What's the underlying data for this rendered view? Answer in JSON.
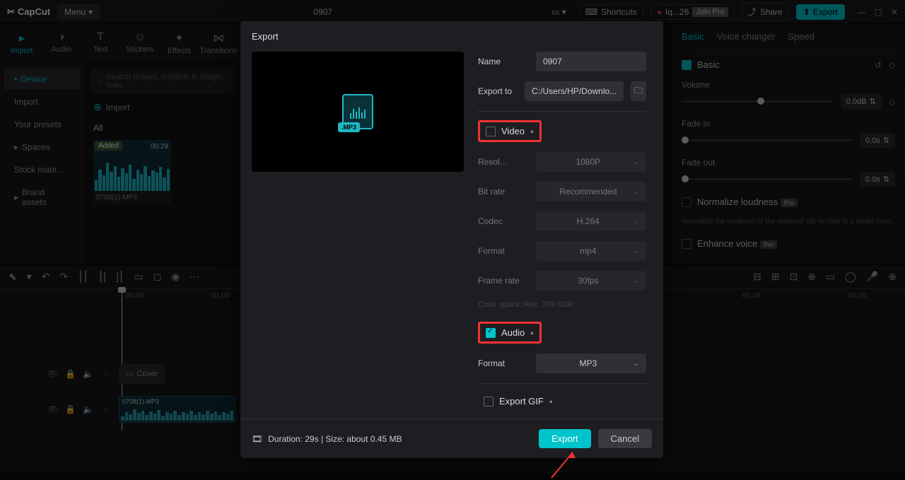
{
  "app": {
    "name": "CapCut",
    "menu": "Menu",
    "project_title": "0907"
  },
  "topbar": {
    "shortcuts": "Shortcuts",
    "user": "Iq...26",
    "join_pro": "Join Pro",
    "share": "Share",
    "export": "Export"
  },
  "leftTabs": [
    "Import",
    "Audio",
    "Text",
    "Stickers",
    "Effects",
    "Transitions"
  ],
  "leftNav": {
    "device": "Device",
    "import": "Import",
    "presets": "Your presets",
    "spaces": "Spaces",
    "stock": "Stock mate...",
    "brand": "Brand assets"
  },
  "center": {
    "search_placeholder": "Search project, subjects in image, lines",
    "import_btn": "Import",
    "tab_all": "All",
    "clip": {
      "badge": "Added",
      "duration": "00:29",
      "filename": "0708(1).MP3"
    }
  },
  "rightPanel": {
    "tabs": {
      "basic": "Basic",
      "voice": "Voice changer",
      "speed": "Speed"
    },
    "basic_label": "Basic",
    "volume": {
      "label": "Volume",
      "value": "0.0dB"
    },
    "fadein": {
      "label": "Fade in",
      "value": "0.0s"
    },
    "fadeout": {
      "label": "Fade out",
      "value": "0.0s"
    },
    "normalize": {
      "label": "Normalize loudness",
      "badge": "Pro",
      "help": "Normalize the loudness of the selected clip or clips to a target level."
    },
    "enhance": {
      "label": "Enhance voice",
      "badge": "Pro"
    }
  },
  "timeline": {
    "marks": [
      "00:00",
      "01:00",
      "01:10",
      "01:20"
    ],
    "cover": "Cover",
    "clip_name": "0708(1).MP3"
  },
  "export": {
    "title": "Export",
    "name": {
      "label": "Name",
      "value": "0907"
    },
    "exportto": {
      "label": "Export to",
      "value": "C:/Users/HP/Downlo..."
    },
    "video": {
      "label": "Video",
      "resolution": {
        "label": "Resol...",
        "value": "1080P"
      },
      "bitrate": {
        "label": "Bit rate",
        "value": "Recommended"
      },
      "codec": {
        "label": "Codec",
        "value": "H.264"
      },
      "format": {
        "label": "Format",
        "value": "mp4"
      },
      "framerate": {
        "label": "Frame rate",
        "value": "30fps"
      },
      "colorspace": "Color space: Rec. 709 SDR"
    },
    "audio": {
      "label": "Audio",
      "format": {
        "label": "Format",
        "value": "MP3"
      }
    },
    "gif": {
      "label": "Export GIF"
    },
    "footer_info": "Duration: 29s | Size: about 0.45 MB",
    "export_btn": "Export",
    "cancel_btn": "Cancel"
  }
}
